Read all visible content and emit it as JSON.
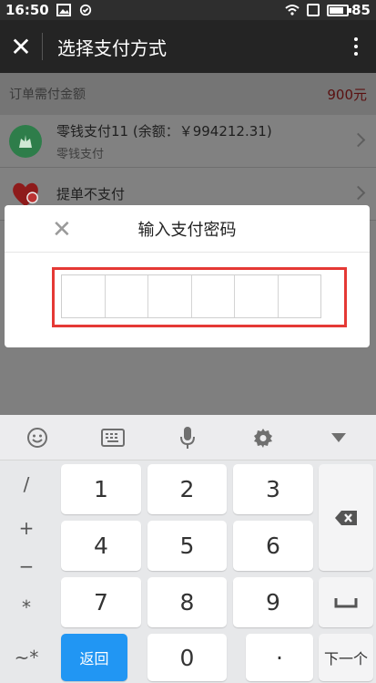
{
  "status_bar": {
    "time": "16:50",
    "battery": "85",
    "battery_level": 0.85
  },
  "app_bar": {
    "title": "选择支付方式",
    "close_icon": "close-icon",
    "menu_icon": "more-vert-icon"
  },
  "order": {
    "label": "订单需付金额",
    "amount": "900元"
  },
  "payment_methods": [
    {
      "main": "零钱支付11 (余额：￥994212.31)",
      "sub": "零钱支付",
      "icon": "wallet-icon",
      "color": "#2e9b4e"
    },
    {
      "main": "提单不支付",
      "sub": "",
      "icon": "heart-icon",
      "color": "#c62828"
    }
  ],
  "dialog": {
    "title": "输入支付密码",
    "close_icon": "close-icon",
    "digits": 6,
    "accent": "#e53935"
  },
  "keyboard": {
    "toolbar": [
      "emoji-icon",
      "keyboard-icon",
      "mic-icon",
      "settings-icon",
      "collapse-icon"
    ],
    "symbols": [
      "/",
      "+",
      "−",
      "*",
      "~*"
    ],
    "digits": [
      "1",
      "2",
      "3",
      "4",
      "5",
      "6",
      "7",
      "8",
      "9",
      "0"
    ],
    "return_label": "返回",
    "dot_label": "·",
    "next_label": "下一个",
    "accent": "#2196f3"
  }
}
